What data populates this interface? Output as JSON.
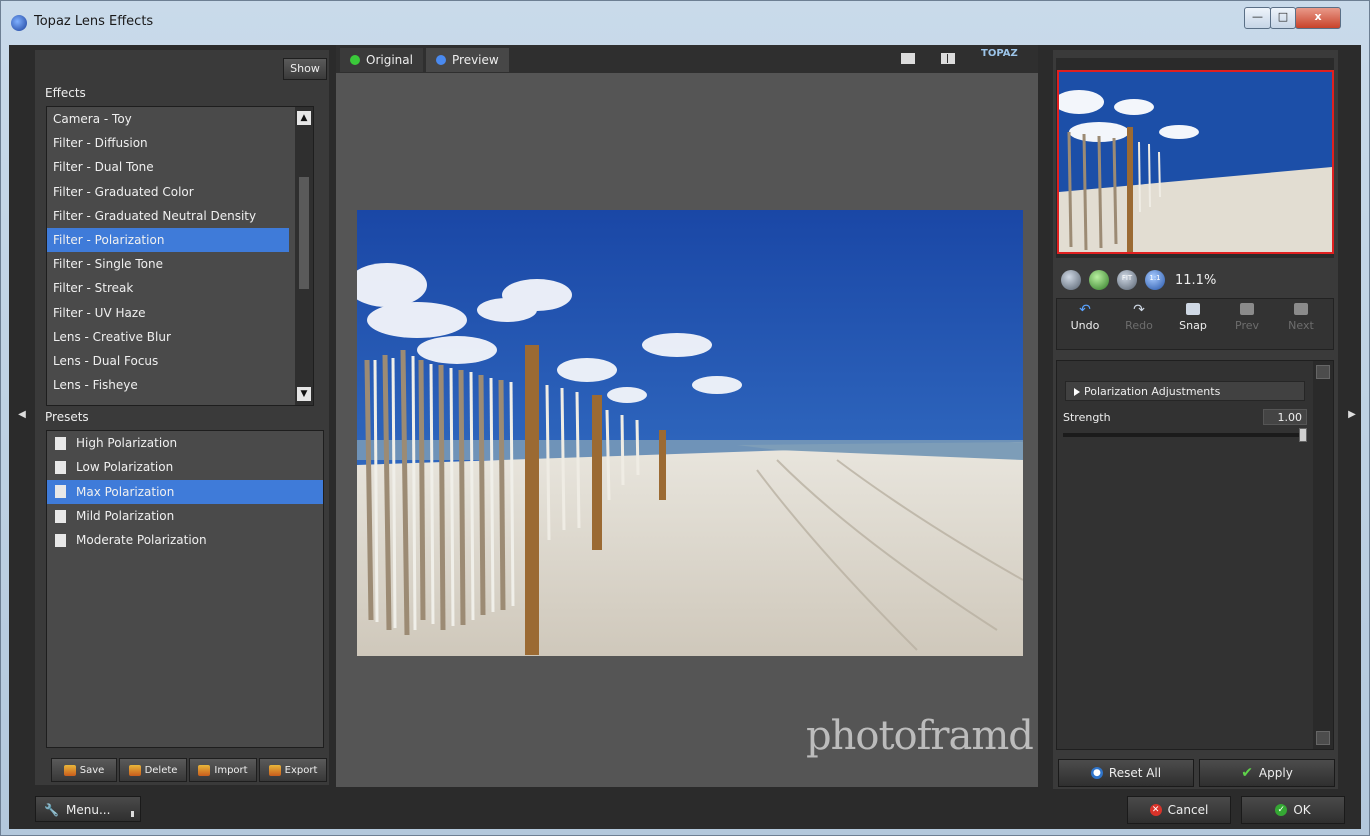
{
  "window": {
    "title": "Topaz Lens Effects",
    "min_label": "—",
    "max_label": "□",
    "close_label": "x"
  },
  "left": {
    "show_label": "Show",
    "effects_label": "Effects",
    "effects": [
      "Camera - Toy",
      "Filter - Diffusion",
      "Filter - Dual Tone",
      "Filter - Graduated Color",
      "Filter - Graduated Neutral Density",
      "Filter - Polarization",
      "Filter - Single Tone",
      "Filter - Streak",
      "Filter - UV Haze",
      "Lens - Creative Blur",
      "Lens - Dual Focus",
      "Lens - Fisheye"
    ],
    "effects_selected": "Filter - Polarization",
    "presets_label": "Presets",
    "presets": [
      "High Polarization",
      "Low Polarization",
      "Max Polarization",
      "Mild Polarization",
      "Moderate Polarization"
    ],
    "presets_selected": "Max Polarization",
    "buttons": {
      "save": "Save",
      "delete": "Delete",
      "import": "Import",
      "export": "Export"
    }
  },
  "center": {
    "tab_original": "Original",
    "tab_preview": "Preview",
    "logo": "TOPAZ",
    "watermark": "photoframd"
  },
  "right": {
    "zoom": "11.1%",
    "zoom_fit": "FIT",
    "zoom_1to1": "1:1",
    "history": {
      "undo": "Undo",
      "redo": "Redo",
      "snap": "Snap",
      "prev": "Prev",
      "next": "Next"
    },
    "section": "Polarization Adjustments",
    "strength_label": "Strength",
    "strength_value": "1.00",
    "strength_fraction": 1.0,
    "reset_all": "Reset All",
    "apply": "Apply"
  },
  "bottom": {
    "menu": "Menu...",
    "cancel": "Cancel",
    "ok": "OK"
  },
  "colors": {
    "selection": "#3f7bd9",
    "sky": "#1b4fae",
    "nav_border": "#e02020"
  }
}
